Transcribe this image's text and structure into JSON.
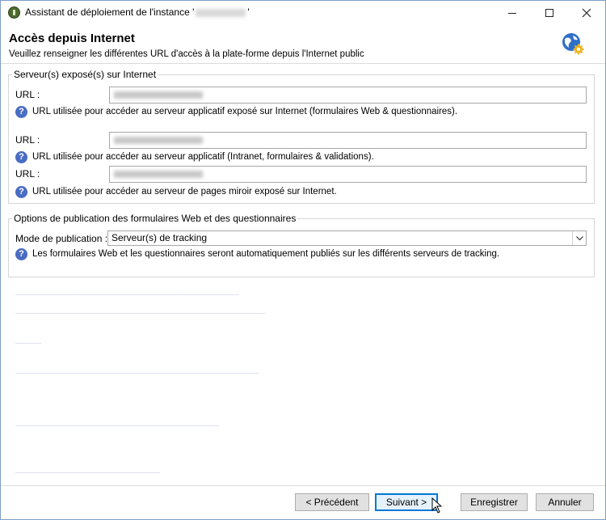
{
  "window": {
    "title_prefix": "Assistant de déploiement de l'instance '",
    "title_suffix": "'",
    "minimize": "minimize",
    "maximize": "maximize",
    "close": "close"
  },
  "header": {
    "title": "Accès depuis Internet",
    "subtitle": "Veuillez renseigner les différentes URL d'accès à la plate-forme depuis l'Internet public"
  },
  "servers_group": {
    "legend": "Serveur(s) exposé(s) sur Internet",
    "rows": [
      {
        "label": "URL :",
        "help": "URL utilisée pour accéder au serveur applicatif exposé sur Internet (formulaires Web & questionnaires)."
      },
      {
        "label": "URL :",
        "help": "URL utilisée pour accéder au serveur applicatif (Intranet, formulaires & validations)."
      },
      {
        "label": "URL :",
        "help": "URL utilisée pour accéder au serveur de pages miroir exposé sur Internet."
      }
    ]
  },
  "publish_group": {
    "legend": "Options de publication des formulaires Web et des questionnaires",
    "mode_label": "Mode de publication :",
    "mode_value": "Serveur(s) de tracking",
    "help": "Les formulaires Web et les questionnaires seront automatiquement publiés sur les différents serveurs de tracking."
  },
  "footer": {
    "prev": "< Précédent",
    "next": "Suivant >",
    "save": "Enregistrer",
    "cancel": "Annuler"
  },
  "icons": {
    "app": "app-icon",
    "globe": "globe-gear-icon",
    "help": "question-icon",
    "dropdown": "chevron-down-icon"
  }
}
